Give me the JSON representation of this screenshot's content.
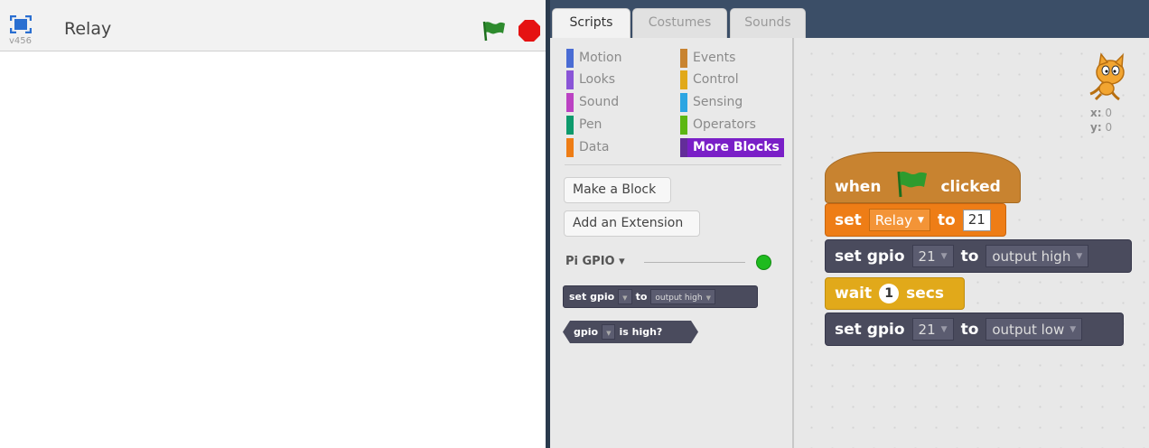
{
  "stage": {
    "version": "v456",
    "title": "Relay"
  },
  "tabs": [
    "Scripts",
    "Costumes",
    "Sounds"
  ],
  "categories": [
    {
      "label": "Motion",
      "color": "#4a6cd4"
    },
    {
      "label": "Events",
      "color": "#c88330"
    },
    {
      "label": "Looks",
      "color": "#8a55d7"
    },
    {
      "label": "Control",
      "color": "#e1a91a"
    },
    {
      "label": "Sound",
      "color": "#bb42c3"
    },
    {
      "label": "Sensing",
      "color": "#2ca5e2"
    },
    {
      "label": "Pen",
      "color": "#0e9a6c"
    },
    {
      "label": "Operators",
      "color": "#5cb712"
    },
    {
      "label": "Data",
      "color": "#ee7d16"
    },
    {
      "label": "More Blocks",
      "color": "#632d99"
    }
  ],
  "palette": {
    "make_block": "Make a Block",
    "add_extension": "Add an Extension",
    "extension_name": "Pi GPIO ▾",
    "block1": {
      "a": "set gpio",
      "b": "to",
      "c": "output high"
    },
    "block2": {
      "a": "gpio",
      "b": "is high?"
    }
  },
  "scripts": {
    "hat": {
      "when": "when",
      "clicked": "clicked"
    },
    "set_var": {
      "set": "set",
      "var": "Relay",
      "to": "to",
      "value": "21"
    },
    "gpio1": {
      "label": "set gpio",
      "pin": "21",
      "to": "to",
      "mode": "output high"
    },
    "wait": {
      "label": "wait",
      "value": "1",
      "unit": "secs"
    },
    "gpio2": {
      "label": "set gpio",
      "pin": "21",
      "to": "to",
      "mode": "output low"
    }
  },
  "sprite": {
    "x_label": "x:",
    "x": "0",
    "y_label": "y:",
    "y": "0"
  }
}
